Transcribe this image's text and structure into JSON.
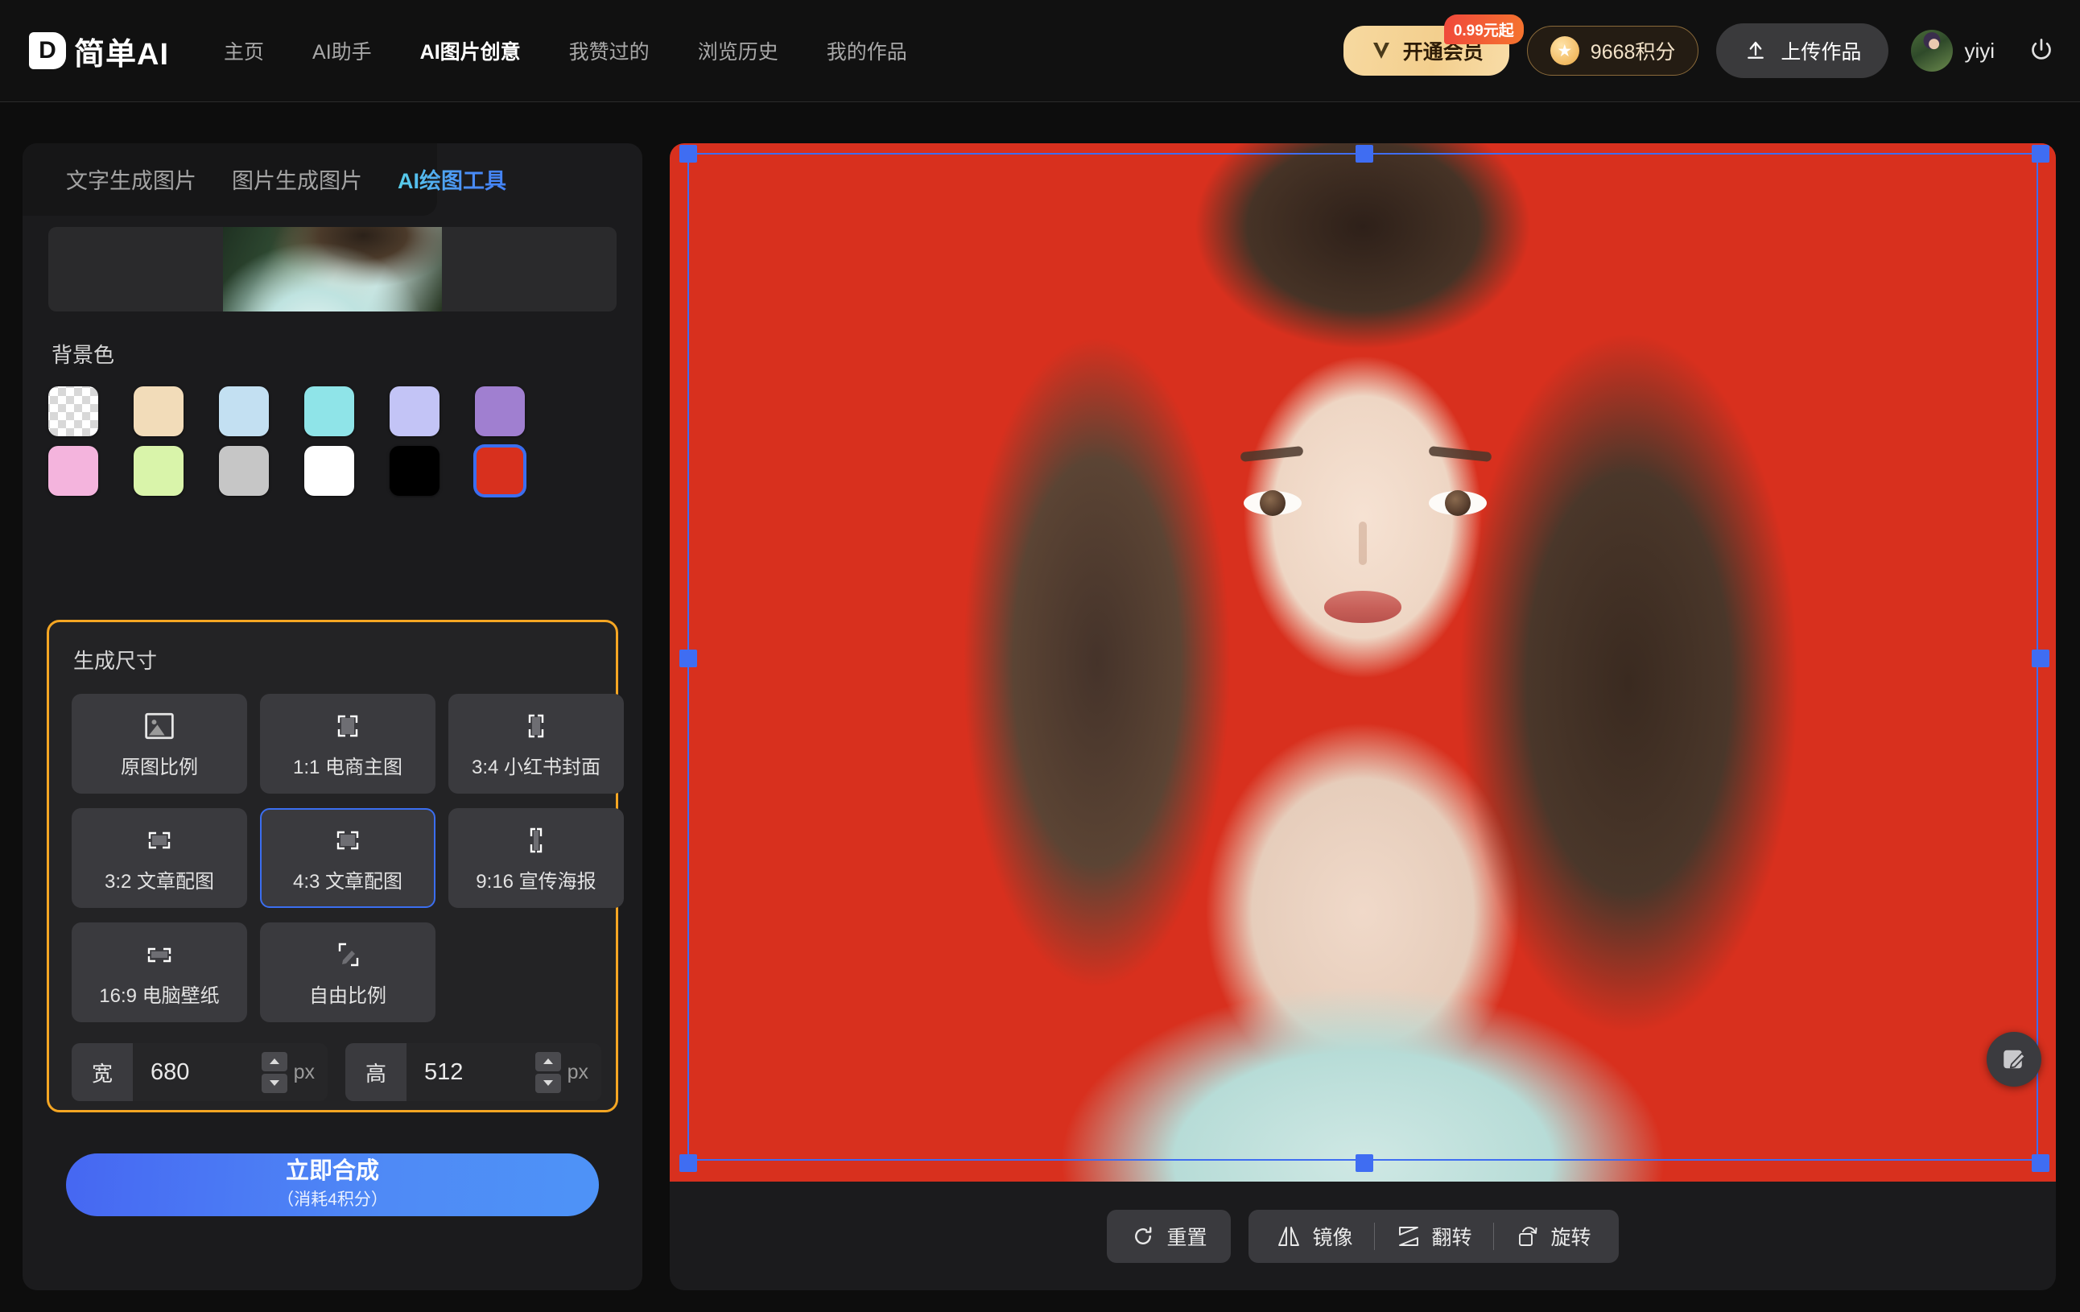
{
  "header": {
    "brand": {
      "mark": "D",
      "name": "简单AI"
    },
    "nav": [
      {
        "label": "主页",
        "active": false
      },
      {
        "label": "AI助手",
        "active": false
      },
      {
        "label": "AI图片创意",
        "active": true
      },
      {
        "label": "我赞过的",
        "active": false
      },
      {
        "label": "浏览历史",
        "active": false
      },
      {
        "label": "我的作品",
        "active": false
      }
    ],
    "vip": {
      "label": "开通会员",
      "badge": "0.99元起",
      "icon": "vip-v-icon"
    },
    "points": {
      "label": "9668积分",
      "icon": "coin-star-icon"
    },
    "upload": {
      "label": "上传作品",
      "icon": "upload-arrow-icon"
    },
    "user": {
      "name": "yiyi",
      "avatar": "user-avatar"
    },
    "power": "power-icon"
  },
  "sidebar": {
    "tabs": [
      {
        "label": "文字生成图片",
        "active": false
      },
      {
        "label": "图片生成图片",
        "active": false
      },
      {
        "label": "AI绘图工具",
        "active": true
      }
    ],
    "background": {
      "label": "背景色",
      "swatches": [
        {
          "name": "transparent",
          "color": "transparent",
          "selected": false
        },
        {
          "name": "beige",
          "color": "#f2dcb9",
          "selected": false
        },
        {
          "name": "light-blue",
          "color": "#c3e0f2",
          "selected": false
        },
        {
          "name": "cyan",
          "color": "#8fe4e8",
          "selected": false
        },
        {
          "name": "periwinkle",
          "color": "#c3c4f6",
          "selected": false
        },
        {
          "name": "purple",
          "color": "#a07fd0",
          "selected": false
        },
        {
          "name": "pink",
          "color": "#f4b4dd",
          "selected": false
        },
        {
          "name": "light-green",
          "color": "#d9f4aa",
          "selected": false
        },
        {
          "name": "gray",
          "color": "#c6c6c6",
          "selected": false
        },
        {
          "name": "white",
          "color": "#ffffff",
          "selected": false
        },
        {
          "name": "black",
          "color": "#000000",
          "selected": false
        },
        {
          "name": "red",
          "color": "#d8301e",
          "selected": true
        }
      ]
    },
    "size": {
      "label": "生成尺寸",
      "presets": [
        {
          "label": "原图比例",
          "icon": "photo-icon",
          "selected": false,
          "w": 30,
          "h": 26
        },
        {
          "label": "1:1 电商主图",
          "icon": "crop-square-icon",
          "selected": false,
          "w": 28,
          "h": 28
        },
        {
          "label": "3:4 小红书封面",
          "icon": "crop-portrait-icon",
          "selected": false,
          "w": 19,
          "h": 30
        },
        {
          "label": "3:2 文章配图",
          "icon": "crop-landscape-icon",
          "selected": false,
          "w": 32,
          "h": 22
        },
        {
          "label": "4:3 文章配图",
          "icon": "crop-landscape-icon",
          "selected": true,
          "w": 30,
          "h": 24
        },
        {
          "label": "9:16 宣传海报",
          "icon": "crop-tall-icon",
          "selected": false,
          "w": 14,
          "h": 32
        },
        {
          "label": "16:9 电脑壁纸",
          "icon": "crop-wide-icon",
          "selected": false,
          "w": 34,
          "h": 18
        },
        {
          "label": "自由比例",
          "icon": "crop-free-pencil-icon",
          "selected": false,
          "w": 0,
          "h": 0
        }
      ],
      "width": {
        "tag": "宽",
        "value": "680",
        "unit": "px"
      },
      "height": {
        "tag": "高",
        "value": "512",
        "unit": "px"
      }
    },
    "submit": {
      "main": "立即合成",
      "sub": "（消耗4积分）"
    }
  },
  "canvas": {
    "background_color": "#d8301e",
    "selection": {
      "color": "#3f6df2",
      "handles": 8
    },
    "toolbar": {
      "reset": {
        "label": "重置",
        "icon": "reset-icon"
      },
      "items": [
        {
          "label": "镜像",
          "icon": "mirror-icon"
        },
        {
          "label": "翻转",
          "icon": "flip-icon"
        },
        {
          "label": "旋转",
          "icon": "rotate-icon"
        }
      ]
    },
    "edit_fab": {
      "icon": "edit-pencil-icon"
    }
  },
  "colors": {
    "accent_blue": "#3f6df2",
    "accent_orange": "#f5a623",
    "canvas_red": "#d8301e",
    "panel_bg": "#1b1b1d"
  }
}
